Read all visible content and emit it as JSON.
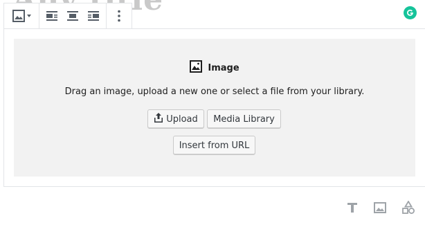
{
  "background_heading": "Any title",
  "toolbar": {
    "block_type_icon": "image-icon",
    "align_left_icon": "align-left-icon",
    "align_center_icon": "align-center-icon",
    "align_right_icon": "align-right-icon",
    "more_icon": "more-vertical-icon"
  },
  "grammarly": {
    "icon": "grammarly-icon",
    "color": "#15c39a"
  },
  "placeholder": {
    "icon": "image-icon",
    "label": "Image",
    "instructions": "Drag an image, upload a new one or select a file from your library.",
    "upload_label": "Upload",
    "media_library_label": "Media Library",
    "insert_url_label": "Insert from URL"
  },
  "inserters": [
    {
      "icon": "paragraph-icon"
    },
    {
      "icon": "image-icon"
    },
    {
      "icon": "shapes-icon"
    }
  ]
}
